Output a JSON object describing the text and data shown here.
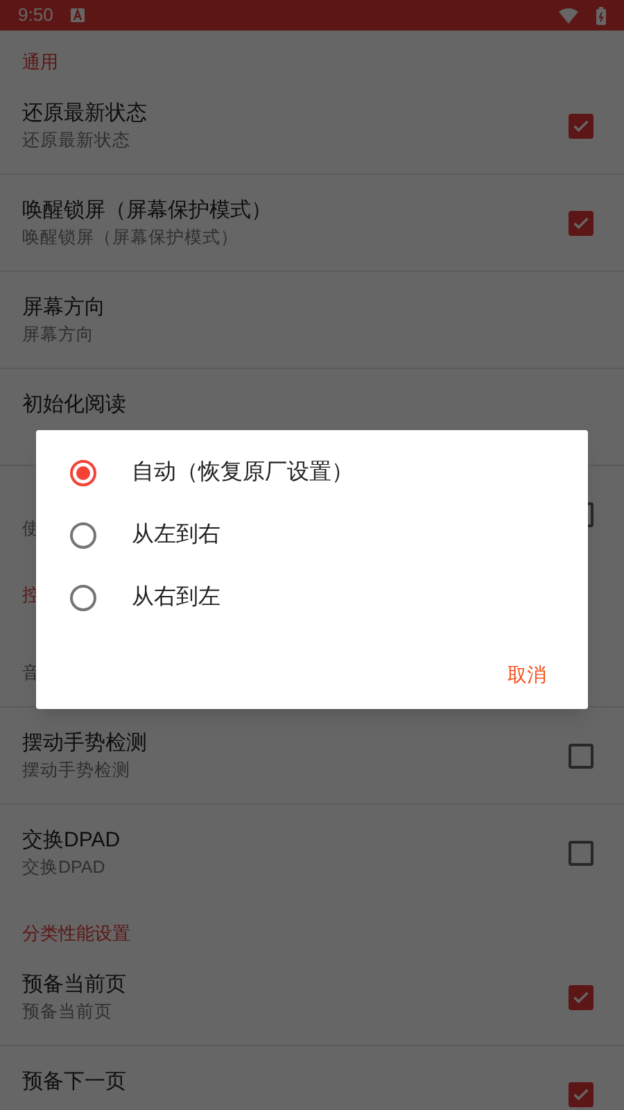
{
  "status_bar": {
    "time": "9:50"
  },
  "sections": [
    {
      "header": "通用",
      "items": [
        {
          "title": "还原最新状态",
          "subtitle": "还原最新状态",
          "kind": "checkbox",
          "checked": true
        },
        {
          "title": "唤醒锁屏（屏幕保护模式）",
          "subtitle": "唤醒锁屏（屏幕保护模式）",
          "kind": "checkbox",
          "checked": true
        },
        {
          "title": "屏幕方向",
          "subtitle": "屏幕方向",
          "kind": "plain"
        },
        {
          "title": "初始化阅读",
          "kind": "plain"
        },
        {
          "subtitle": "使",
          "kind": "checkbox",
          "checked": false
        }
      ]
    },
    {
      "header": "控",
      "items": [
        {
          "subtitle": "音",
          "kind": "plain"
        },
        {
          "title": "摆动手势检测",
          "subtitle": "摆动手势检测",
          "kind": "checkbox",
          "checked": false
        },
        {
          "title": "交换DPAD",
          "subtitle": "交换DPAD",
          "kind": "checkbox",
          "checked": false
        }
      ]
    },
    {
      "header": "分类性能设置",
      "items": [
        {
          "title": "预备当前页",
          "subtitle": "预备当前页",
          "kind": "checkbox",
          "checked": true
        },
        {
          "title": "预备下一页",
          "kind": "checkbox",
          "checked": true
        }
      ]
    }
  ],
  "dialog": {
    "options": [
      {
        "label": "自动（恢复原厂设置）",
        "selected": true
      },
      {
        "label": "从左到右",
        "selected": false
      },
      {
        "label": "从右到左",
        "selected": false
      }
    ],
    "cancel": "取消"
  }
}
